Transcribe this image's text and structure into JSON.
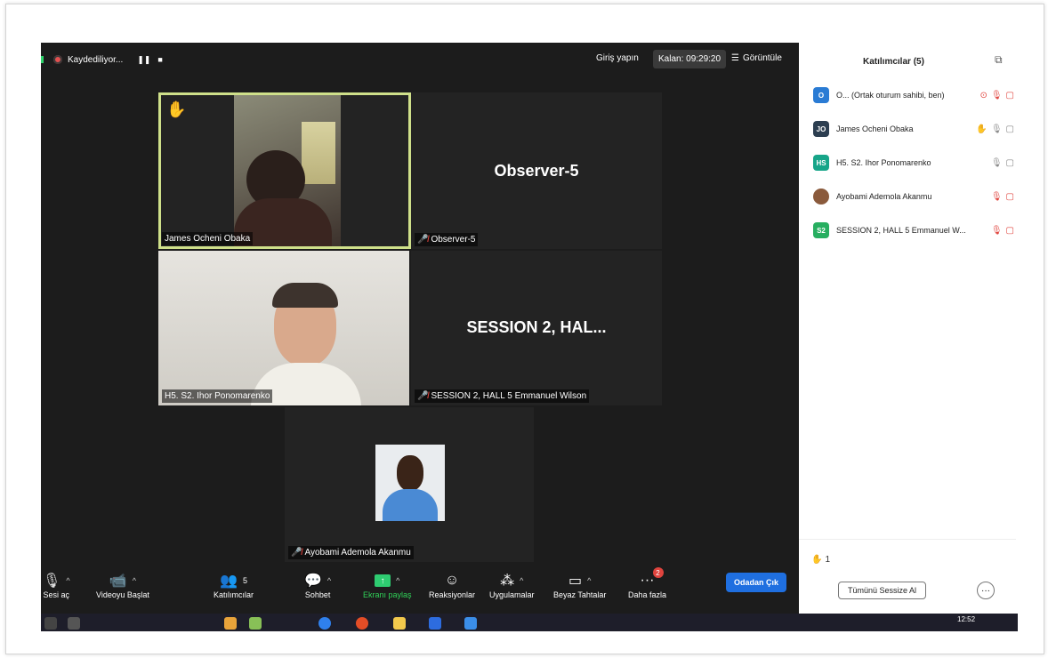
{
  "topbar": {
    "recording_label": "Kaydediliyor...",
    "pause_glyph": "❚❚",
    "stop_glyph": "■",
    "signin_label": "Giriş yapın",
    "timer_label": "Kalan: 09:29:20",
    "view_label": "Görüntüle"
  },
  "tiles": [
    {
      "name": "James Ocheni Obaka",
      "active": true,
      "hand_raised": true,
      "muted": false
    },
    {
      "name": "Observer-5",
      "display_name": "Observer-5",
      "muted": true
    },
    {
      "name": "H5. S2. Ihor Ponomarenko",
      "muted": false
    },
    {
      "name": "SESSION 2, HALL 5 Emmanuel Wilson",
      "display_name": "SESSION 2, HAL...",
      "muted": true
    },
    {
      "name": "Ayobami  Ademola Akanmu",
      "muted": true
    }
  ],
  "toolbar": {
    "audio": "Sesi aç",
    "video": "Videoyu Başlat",
    "participants": "Katılımcılar",
    "participants_count": "5",
    "chat": "Sohbet",
    "share": "Ekranı paylaş",
    "reactions": "Reaksiyonlar",
    "apps": "Uygulamalar",
    "whiteboard": "Beyaz Tahtalar",
    "more": "Daha fazla",
    "more_badge": "2",
    "leave": "Odadan Çık"
  },
  "panel": {
    "title": "Katılımcılar (5)",
    "participants": [
      {
        "initials": "O",
        "color": "#2a7bd4",
        "name": "O... (Ortak oturum sahibi, ben)"
      },
      {
        "initials": "JO",
        "color": "#2c3e50",
        "name": "James Ocheni Obaka"
      },
      {
        "initials": "HS",
        "color": "#17a589",
        "name": "H5. S2. Ihor Ponomarenko"
      },
      {
        "initials": "",
        "color": "#8a5a3c",
        "name": "Ayobami  Ademola Akanmu"
      },
      {
        "initials": "S2",
        "color": "#27ae60",
        "name": "SESSION 2, HALL 5 Emmanuel W..."
      }
    ],
    "raised_hands": "1",
    "mute_all": "Tümünü Sessize Al",
    "more": "···"
  },
  "taskbar": {
    "clock": "12:52"
  },
  "colors": {
    "meeting_bg": "#1c1c1c",
    "active_border": "#cfe08a",
    "mute_red": "#e0443e",
    "leave_blue": "#1f6fe0",
    "share_green": "#2ecc71"
  }
}
